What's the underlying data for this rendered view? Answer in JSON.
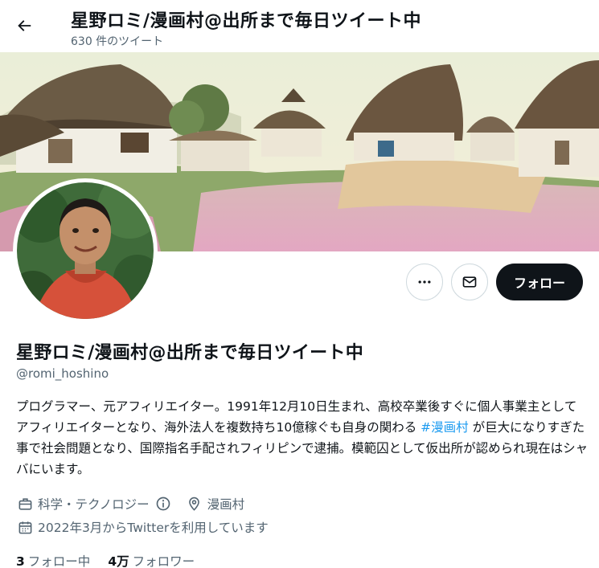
{
  "header": {
    "title": "星野ロミ/漫画村@出所まで毎日ツイート中",
    "tweet_count": "630 件のツイート"
  },
  "profile": {
    "name": "星野ロミ/漫画村@出所まで毎日ツイート中",
    "handle": "@romi_hoshino",
    "bio_part1": "プログラマー、元アフィリエイター。1991年12月10日生まれ、高校卒業後すぐに個人事業主としてアフィリエイターとなり、海外法人を複数持ち10億稼ぐも自身の関わる ",
    "bio_hashtag": "#漫画村",
    "bio_part2": " が巨大になりすぎた事で社会問題となり、国際指名手配されフィリピンで逮捕。模範囚として仮出所が認められ現在はシャバにいます。",
    "category": "科学・テクノロジー",
    "location": "漫画村",
    "joined": "2022年3月からTwitterを利用しています",
    "following_count": "3",
    "following_label": "フォロー中",
    "followers_count": "4万",
    "followers_label": "フォロワー"
  },
  "actions": {
    "follow_label": "フォロー"
  },
  "icons": {
    "back": "arrow-left-icon",
    "more": "more-horizontal-icon",
    "message": "envelope-icon",
    "category": "briefcase-icon",
    "info": "info-icon",
    "location": "location-pin-icon",
    "calendar": "calendar-icon"
  },
  "colors": {
    "link": "#1d9bf0",
    "secondary_text": "#536471",
    "primary_text": "#0f1419",
    "follow_button": "#0f1419"
  }
}
